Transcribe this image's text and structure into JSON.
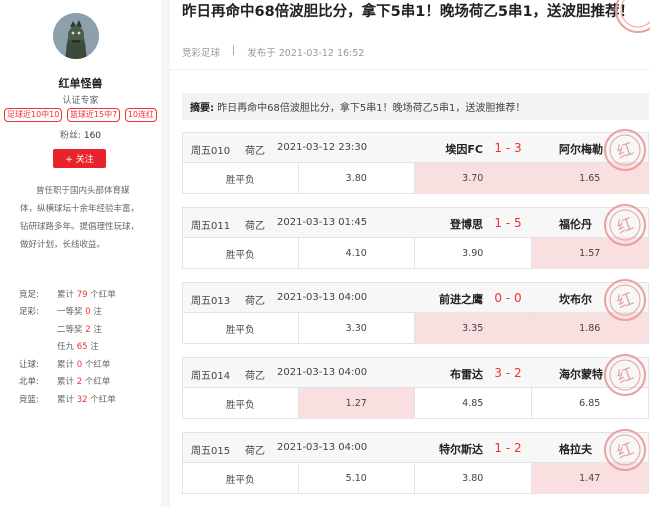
{
  "sidebar": {
    "avatar": "godzilla-avatar",
    "name": "红单怪兽",
    "role": "认证专家",
    "tags": [
      "足球近10中10",
      "篮球近15中7",
      "10连红"
    ],
    "fans_label": "粉丝:",
    "fans_count": "160",
    "follow_label": "+ 关注",
    "bio": "曾任职于国内头部体育媒体，纵横球坛十余年经验丰富，钻研球路多年。提倡理性玩球，做好计划，长线收益。",
    "stats": [
      {
        "label": "竞足:",
        "prefix": "累计 ",
        "num": "79",
        "suffix": " 个红单"
      },
      {
        "label": "足彩:",
        "prefix": "一等奖 ",
        "num": "0",
        "suffix": " 注"
      },
      {
        "label": "",
        "prefix": "二等奖 ",
        "num": "2",
        "suffix": " 注"
      },
      {
        "label": "",
        "prefix": "任九 ",
        "num": "65",
        "suffix": " 注"
      },
      {
        "label": "让球:",
        "prefix": "累计 ",
        "num": "0",
        "suffix": " 个红单"
      },
      {
        "label": "北单:",
        "prefix": "累计 ",
        "num": "2",
        "suffix": " 个红单"
      },
      {
        "label": "竞篮:",
        "prefix": "累计 ",
        "num": "32",
        "suffix": " 个红单"
      }
    ]
  },
  "article": {
    "title": "昨日再命中68倍波胆比分，拿下5串1！晚场荷乙5串1，送波胆推荐！",
    "category": "竞彩足球",
    "separator": "|",
    "published": "发布于 2021-03-12 16:52",
    "summary_label": "摘要:",
    "summary_text": "昨日再命中68倍波胆比分，拿下5串1！晚场荷乙5串1，送波胆推荐！",
    "stamp_text": "红"
  },
  "matches": [
    {
      "no": "周五010",
      "league": "荷乙",
      "time": "2021-03-12 23:30",
      "home": "埃因FC",
      "score": "1 - 3",
      "away": "阿尔梅勒",
      "market": "胜平负",
      "odds": [
        "3.80",
        "3.70",
        "1.65"
      ],
      "hit": [
        false,
        true,
        true
      ]
    },
    {
      "no": "周五011",
      "league": "荷乙",
      "time": "2021-03-13 01:45",
      "home": "登博思",
      "score": "1 - 5",
      "away": "福伦丹",
      "market": "胜平负",
      "odds": [
        "4.10",
        "3.90",
        "1.57"
      ],
      "hit": [
        false,
        false,
        true
      ]
    },
    {
      "no": "周五013",
      "league": "荷乙",
      "time": "2021-03-13 04:00",
      "home": "前进之鹰",
      "score": "0 - 0",
      "away": "坎布尔",
      "market": "胜平负",
      "odds": [
        "3.30",
        "3.35",
        "1.86"
      ],
      "hit": [
        false,
        true,
        true
      ]
    },
    {
      "no": "周五014",
      "league": "荷乙",
      "time": "2021-03-13 04:00",
      "home": "布雷达",
      "score": "3 - 2",
      "away": "海尔蒙特",
      "market": "胜平负",
      "odds": [
        "1.27",
        "4.85",
        "6.85"
      ],
      "hit": [
        true,
        false,
        false
      ]
    },
    {
      "no": "周五015",
      "league": "荷乙",
      "time": "2021-03-13 04:00",
      "home": "特尔斯达",
      "score": "1 - 2",
      "away": "格拉夫",
      "market": "胜平负",
      "odds": [
        "5.10",
        "3.80",
        "1.47"
      ],
      "hit": [
        false,
        false,
        true
      ]
    }
  ],
  "colors": {
    "accent": "#e8232b",
    "hit": "#f9dfe0"
  }
}
